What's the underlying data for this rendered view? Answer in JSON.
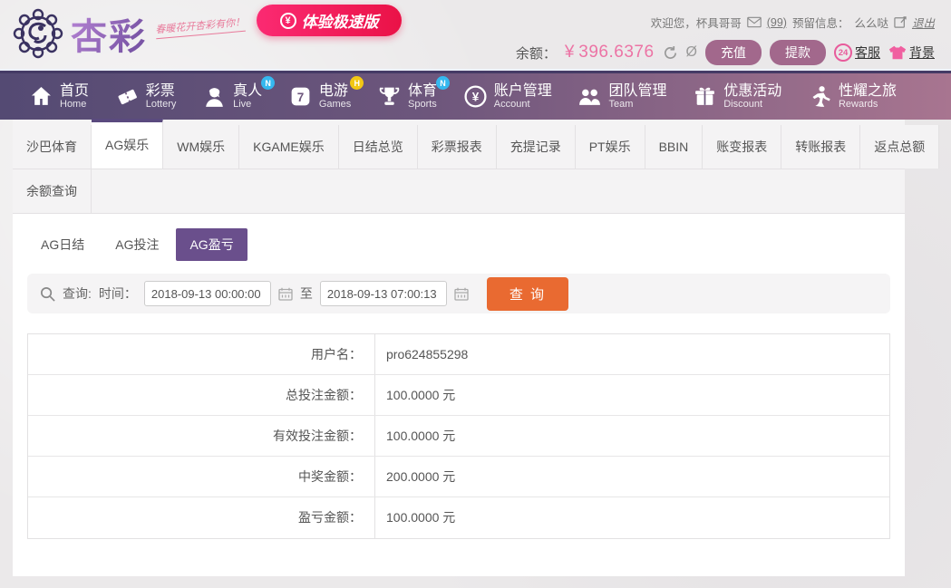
{
  "header": {
    "brand": "杏彩",
    "tagline": "春暖花开杏彩有你！",
    "speed_badge": "体验极速版",
    "userbar": {
      "welcome": "欢迎您，杯具哥哥",
      "mail_count": "(99)",
      "reserved_label": "预留信息：",
      "reserved_value": "么么哒",
      "logout": "退出"
    },
    "balance": {
      "label": "余额：",
      "currency": "¥",
      "amount": "396.6376",
      "recharge": "充值",
      "withdraw": "提款",
      "service_badge": "24",
      "service": "客服",
      "background": "背景"
    }
  },
  "nav": {
    "items": [
      {
        "zh": "首页",
        "en": "Home",
        "icon": "home-icon",
        "badge": ""
      },
      {
        "zh": "彩票",
        "en": "Lottery",
        "icon": "ticket-icon",
        "badge": ""
      },
      {
        "zh": "真人",
        "en": "Live",
        "icon": "live-icon",
        "badge": "N"
      },
      {
        "zh": "电游",
        "en": "Games",
        "icon": "games-icon",
        "badge": "H"
      },
      {
        "zh": "体育",
        "en": "Sports",
        "icon": "sports-icon",
        "badge": "N"
      },
      {
        "zh": "账户管理",
        "en": "Account",
        "icon": "account-icon",
        "badge": ""
      },
      {
        "zh": "团队管理",
        "en": "Team",
        "icon": "team-icon",
        "badge": ""
      },
      {
        "zh": "优惠活动",
        "en": "Discount",
        "icon": "gift-icon",
        "badge": ""
      },
      {
        "zh": "性耀之旅",
        "en": "Rewards",
        "icon": "rewards-icon",
        "badge": ""
      }
    ]
  },
  "tabs": {
    "row1": [
      "沙巴体育",
      "AG娱乐",
      "WM娱乐",
      "KGAME娱乐",
      "日结总览",
      "彩票报表",
      "充提记录",
      "PT娱乐",
      "BBIN",
      "账变报表",
      "转账报表",
      "返点总额"
    ],
    "active": "AG娱乐",
    "row2": [
      "余额查询"
    ]
  },
  "subtabs": {
    "items": [
      "AG日结",
      "AG投注",
      "AG盈亏"
    ],
    "active": "AG盈亏"
  },
  "query": {
    "label": "查询:",
    "time_label": "时间：",
    "from_value": "2018-09-13 00:00:00",
    "to_word": "至",
    "to_value": "2018-09-13 07:00:13",
    "button": "查 询"
  },
  "report": {
    "rows": [
      {
        "label": "用户名：",
        "value": "pro624855298"
      },
      {
        "label": "总投注金额：",
        "value": "100.0000 元"
      },
      {
        "label": "有效投注金额：",
        "value": "100.0000 元"
      },
      {
        "label": "中奖金额：",
        "value": "200.0000 元"
      },
      {
        "label": "盈亏金额：",
        "value": "100.0000 元"
      }
    ]
  },
  "colors": {
    "nav_gradient_start": "#544a73",
    "nav_gradient_end": "#a87590",
    "accent_purple": "#6a4f8c",
    "tab_active_bar": "#5a4a7e",
    "balance_pink": "#ec74a5",
    "button_mauve": "#a2688c",
    "query_orange": "#e96a31",
    "badge_pink_gradient": "#fb2a72"
  }
}
